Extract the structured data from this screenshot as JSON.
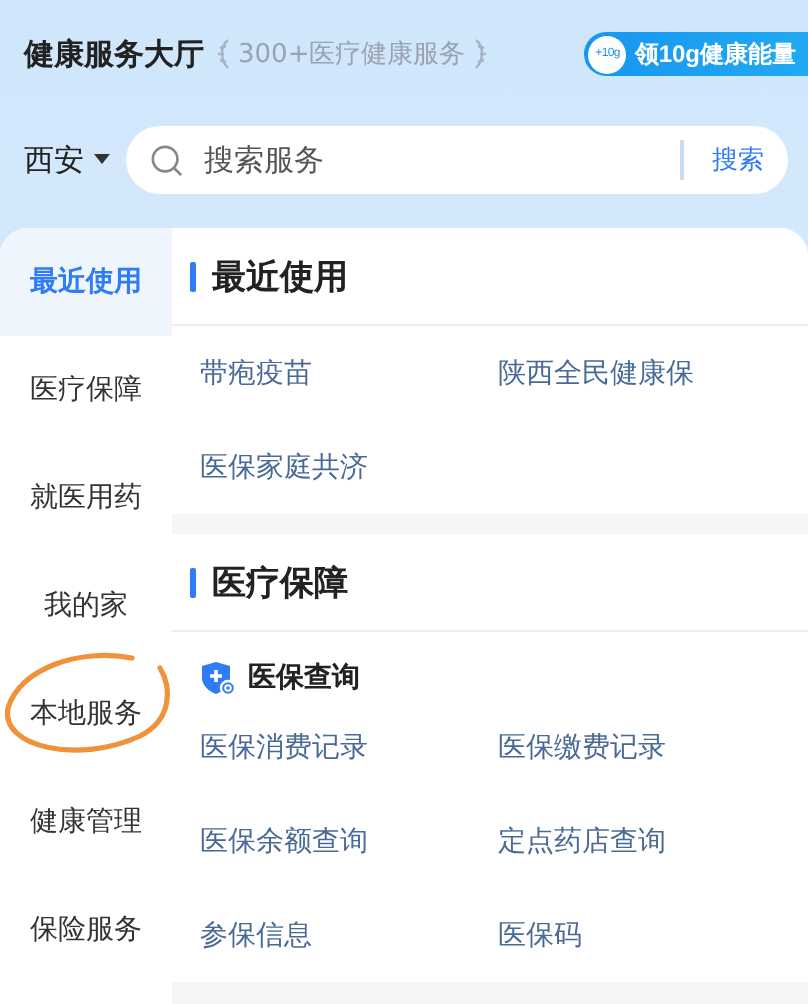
{
  "header": {
    "title": "健康服务大厅",
    "subtitle": "300+医疗健康服务",
    "badge_icon": "+10g",
    "badge_label": "领10g健康能量"
  },
  "search": {
    "city": "西安",
    "placeholder": "搜索服务",
    "button": "搜索"
  },
  "sidebar": {
    "items": [
      {
        "label": "最近使用",
        "selected": true
      },
      {
        "label": "医疗保障",
        "selected": false
      },
      {
        "label": "就医用药",
        "selected": false
      },
      {
        "label": "我的家",
        "selected": false
      },
      {
        "label": "本地服务",
        "selected": false
      },
      {
        "label": "健康管理",
        "selected": false
      },
      {
        "label": "保险服务",
        "selected": false
      }
    ]
  },
  "sections": [
    {
      "title": "最近使用",
      "items": [
        "带疱疫苗",
        "陕西全民健康保",
        "医保家庭共济"
      ]
    },
    {
      "title": "医疗保障",
      "subheading": "医保查询",
      "items": [
        "医保消费记录",
        "医保缴费记录",
        "医保余额查询",
        "定点药店查询",
        "参保信息",
        "医保码"
      ]
    }
  ]
}
